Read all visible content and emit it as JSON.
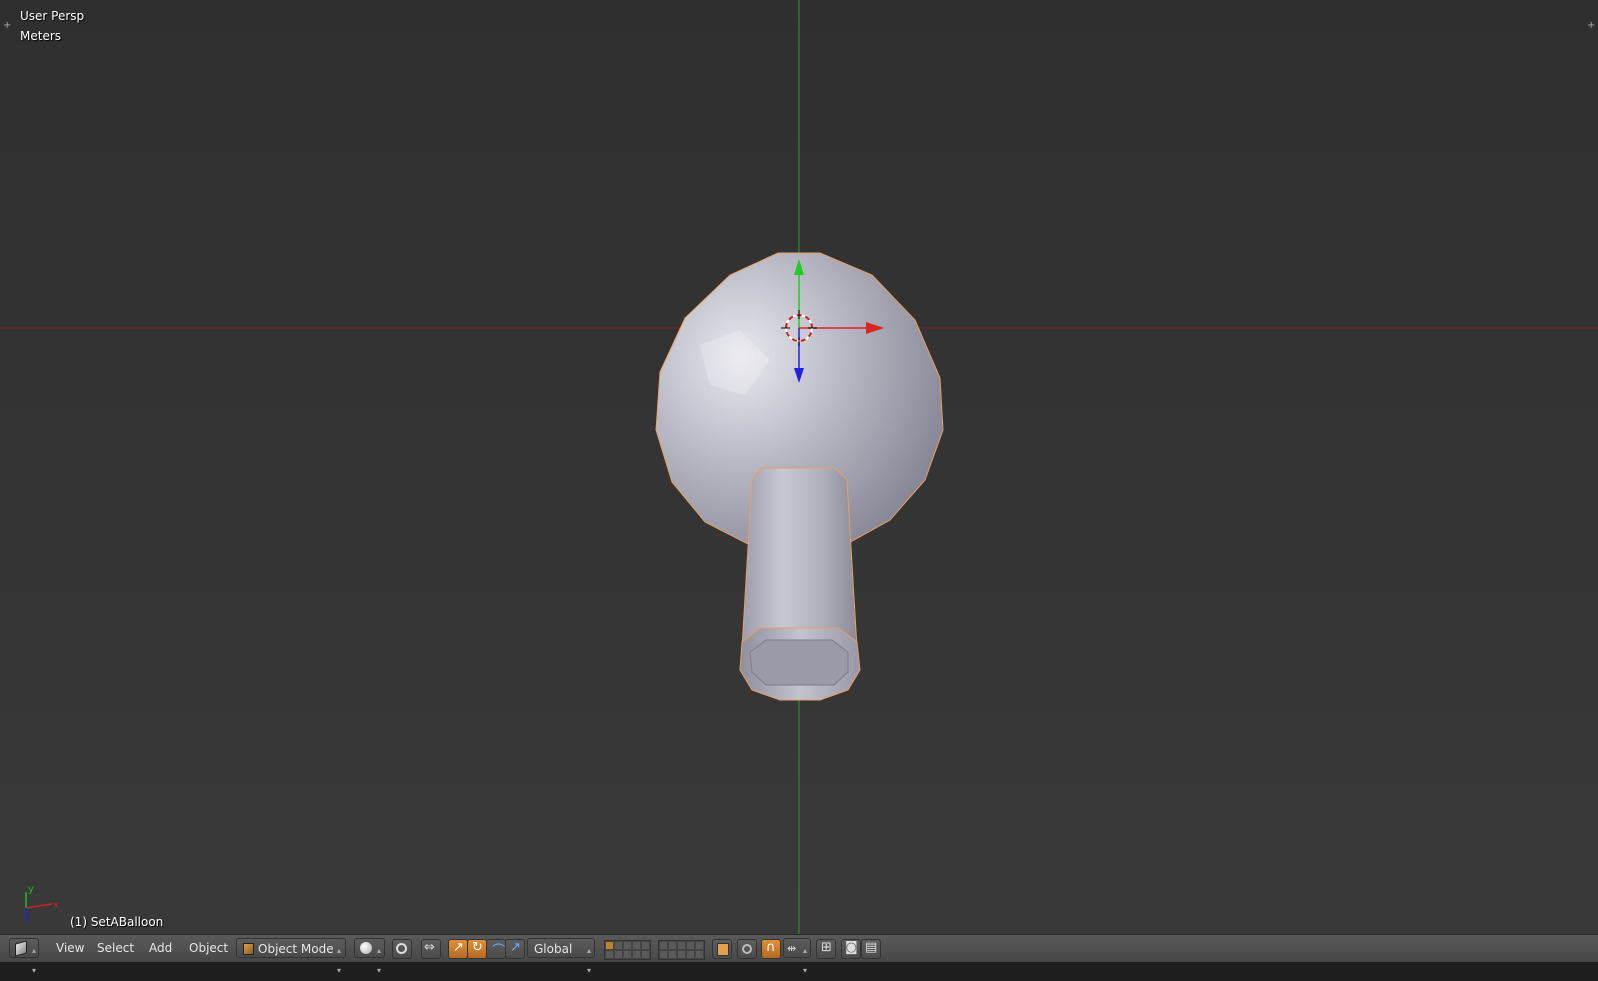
{
  "viewport": {
    "view_name": "User Persp",
    "units": "Meters",
    "object_name": "(1) SetABalloon"
  },
  "axes": {
    "x_label": "x",
    "y_label": "y",
    "x_color": "#cc2222",
    "y_color": "#22bb22",
    "z_color": "#2222dd"
  },
  "header": {
    "menus": [
      "View",
      "Select",
      "Add",
      "Object"
    ],
    "mode": "Object Mode",
    "orientation": "Global"
  },
  "colors": {
    "selection_outline": "#e8a060",
    "header_bg": "#4f4f4f",
    "active_button": "#d28635"
  }
}
